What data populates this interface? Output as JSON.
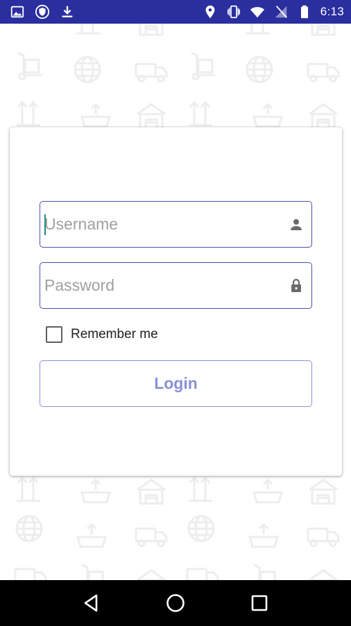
{
  "status_bar": {
    "time": "6:13",
    "left_icons": [
      "image-icon",
      "shield-icon",
      "download-icon"
    ],
    "right_icons": [
      "location-icon",
      "vibrate-icon",
      "wifi-icon",
      "no-signal-icon",
      "battery-icon"
    ],
    "background_color": "#2a2e9e"
  },
  "login_form": {
    "username": {
      "placeholder": "Username",
      "value": ""
    },
    "password": {
      "placeholder": "Password",
      "value": ""
    },
    "remember_label": "Remember me",
    "remember_checked": false,
    "login_label": "Login",
    "accent_color": "#4a4fb0"
  },
  "nav_bar": {
    "buttons": [
      "back-icon",
      "home-icon",
      "recents-icon"
    ]
  }
}
